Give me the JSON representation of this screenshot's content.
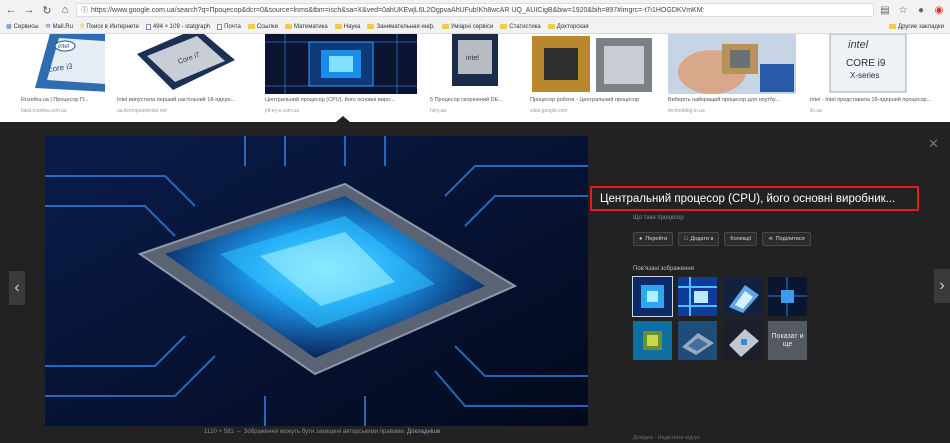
{
  "browser": {
    "url": "https://www.google.com.ua/search?q=Процесор&dcr=0&source=lnms&tbm=isch&sa=X&ved=0ahUKEwjL6L2OgpvaAhUFub!Kh8wcAR UQ_AUICigB&biw=1920&bih=897#imgrc=-t7i1HOGDKVmKM:",
    "bookmarks": [
      {
        "label": "Сервисы",
        "kind": "apps"
      },
      {
        "label": "Mail.Ru",
        "kind": "page"
      },
      {
        "label": "Поиск в Интернете",
        "kind": "page"
      },
      {
        "label": "494 × 109 - statgraph",
        "kind": "page"
      },
      {
        "label": "Почта",
        "kind": "page"
      },
      {
        "label": "Ссылки",
        "kind": "folder"
      },
      {
        "label": "Математика",
        "kind": "folder"
      },
      {
        "label": "Наука",
        "kind": "folder"
      },
      {
        "label": "Занимательная инф.",
        "kind": "folder"
      },
      {
        "label": "Уміарні сервіси",
        "kind": "folder"
      },
      {
        "label": "Статистика",
        "kind": "folder"
      },
      {
        "label": "Докторская",
        "kind": "folder"
      }
    ],
    "other_bookmarks": "Другие закладки"
  },
  "thumbnails": [
    {
      "caption": "Rozetka.ua | Процесор П...",
      "source": "hard.rozetka.com.ua",
      "icon": "intel-core-i3-box"
    },
    {
      "caption": "Intel випустила перший настільний 18-ядерн...",
      "source": "ua.itcomputerenter.net",
      "icon": "intel-core-i7-chip"
    },
    {
      "caption": "Центральний процесор (CPU), його основні виро...",
      "source": "pll-ey-s.com.ua",
      "icon": "glowing-cpu"
    },
    {
      "caption": "5 Процесор скорінений DE...",
      "source": "hmy.ua",
      "icon": "intel-chip-sq"
    },
    {
      "caption": "Процесор роботи - Центральний процесор",
      "source": "sites.google.com",
      "icon": "cpu-pins"
    },
    {
      "caption": "Виберіть найкращий процесор для ноутбу...",
      "source": "technoblog.in.ua",
      "icon": "hand-cpu"
    },
    {
      "caption": "Intel - Intel представила 18-ядерний процесор...",
      "source": "itc.ua",
      "icon": "intel-core-i9-box"
    }
  ],
  "preview": {
    "image_size": "1120 × 581",
    "copyright_note": "Зображення можуть бути захищені авторськими правами.",
    "learn_more": "Докладніше",
    "title": "Центральний процесор (CPU), його основні виробник...",
    "subtitle": "Що таке процесор",
    "actions": [
      {
        "label": "Перейти",
        "icon": "globe-icon"
      },
      {
        "label": "Додати в",
        "icon": "bookmark-icon"
      },
      {
        "label": "Колекції",
        "icon": ""
      },
      {
        "label": "Поділитися",
        "icon": "share-icon"
      }
    ],
    "related_label": "Пов'язані зображення",
    "related_more": "Показат и ще",
    "footer": "Довідка - Надіслати відгук"
  },
  "colors": {
    "highlight_border": "#e11d1d",
    "panel_bg": "#222222"
  }
}
